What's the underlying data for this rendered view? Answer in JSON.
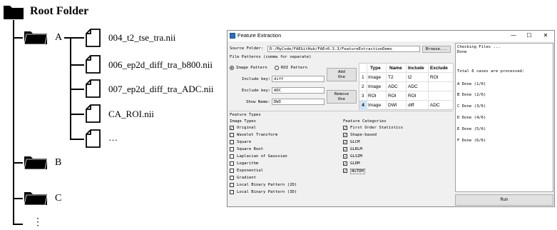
{
  "tree": {
    "root": "Root Folder",
    "folder_a": "A",
    "folder_b": "B",
    "folder_c": "C",
    "more_folders": "⋮",
    "files": [
      "004_t2_tse_tra.nii",
      "006_ep2d_diff_tra_b800.nii",
      "007_ep2d_diff_tra_ADC.nii",
      "CA_ROI.nii",
      "…"
    ]
  },
  "window": {
    "title": "Feature Extraction",
    "minimize": "—",
    "maximize": "☐",
    "close": "✕",
    "source_label": "Source Folder:",
    "source_value": "D:/MyCode/FAEGitHub/FAE+0.3.3/FeatureExtractionDemo",
    "browse": "Browse...",
    "file_patterns": "File Patterns (comma for separate)",
    "image_pattern": "Image Pattern",
    "roi_pattern": "ROI Pattern",
    "include_label": "Include key:",
    "include_value": "diff",
    "exclude_label": "Exclude key:",
    "exclude_value": "ADC",
    "showname_label": "Show Name:",
    "showname_value": "DWI",
    "add_one_1": "Add",
    "add_one_2": "One",
    "remove_one_1": "Remove",
    "remove_one_2": "One",
    "table": {
      "headers": [
        "Type",
        "Name",
        "Include",
        "Exclude"
      ],
      "rows": [
        {
          "n": "1",
          "type": "Image",
          "name": "T2",
          "include": "t2",
          "exclude": "ROI"
        },
        {
          "n": "2",
          "type": "Image",
          "name": "ADC",
          "include": "ADC",
          "exclude": ""
        },
        {
          "n": "3",
          "type": "ROI",
          "name": "ROI",
          "include": "ROI",
          "exclude": ""
        },
        {
          "n": "4",
          "type": "Image",
          "name": "DWI",
          "include": "diff",
          "exclude": "ADC"
        }
      ]
    },
    "feature_types": "Feature Types",
    "image_types": "Image Types",
    "image_type_items": [
      {
        "label": "Original",
        "checked": true
      },
      {
        "label": "Wavelet Transform",
        "checked": false
      },
      {
        "label": "Square",
        "checked": false
      },
      {
        "label": "Square Root",
        "checked": false
      },
      {
        "label": "Laplacian of Gaussian",
        "checked": false
      },
      {
        "label": "Logarithm",
        "checked": false
      },
      {
        "label": "Exponential",
        "checked": false
      },
      {
        "label": "Gradient",
        "checked": false
      },
      {
        "label": "Local Binary Pattern (2D)",
        "checked": false
      },
      {
        "label": "Local Binary Pattern (3D)",
        "checked": false
      }
    ],
    "feature_categories": "Feature Categories",
    "feature_category_items": [
      {
        "label": "First Order Statistics",
        "checked": true
      },
      {
        "label": "Shape-based",
        "checked": true
      },
      {
        "label": "GLCM",
        "checked": true
      },
      {
        "label": "GLRLM",
        "checked": true
      },
      {
        "label": "GLSZM",
        "checked": true
      },
      {
        "label": "GLDM",
        "checked": true
      },
      {
        "label": "NGTDM",
        "checked": true
      }
    ],
    "log": [
      "Checking Files ...",
      "Done",
      "",
      "Total 6 cases are processed:",
      "",
      "A Done (1/6)",
      "",
      "B Done (2/6)",
      "",
      "C Done (3/6)",
      "",
      "D Done (4/6)",
      "",
      "E Done (5/6)",
      "",
      "F Done (6/6)"
    ],
    "run": "Run"
  }
}
